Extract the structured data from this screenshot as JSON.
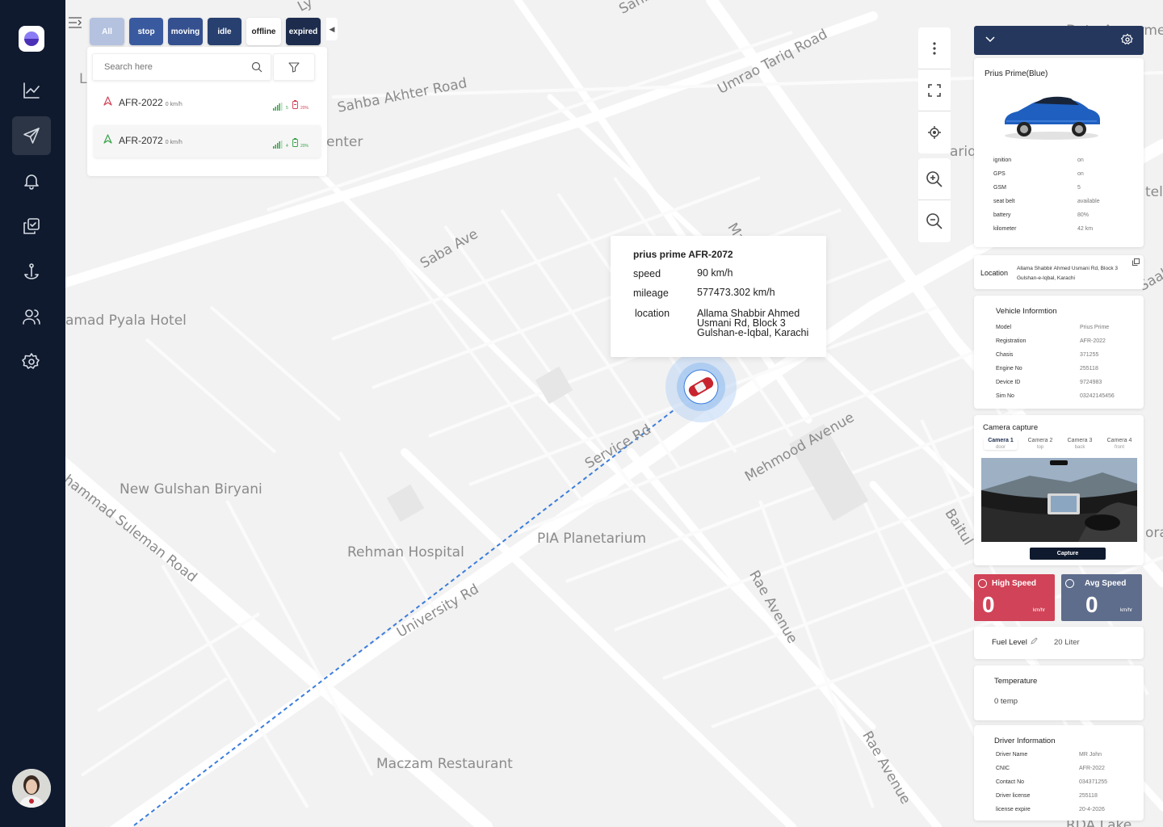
{
  "nav": {
    "items": [
      {
        "label": "analytics",
        "icon": "chart-line-icon"
      },
      {
        "label": "tracking",
        "icon": "navigation-icon",
        "active": true
      },
      {
        "label": "alerts",
        "icon": "bell-icon"
      },
      {
        "label": "tasks",
        "icon": "checklist-icon"
      },
      {
        "label": "geofence",
        "icon": "anchor-pin-icon"
      },
      {
        "label": "users",
        "icon": "users-icon"
      },
      {
        "label": "settings",
        "icon": "gear-icon"
      }
    ]
  },
  "filters": [
    {
      "label": "All",
      "color": "#b4c2e0",
      "text": "#ffffff"
    },
    {
      "label": "stop",
      "color": "#3a5a9f",
      "text": "#ffffff"
    },
    {
      "label": "moving",
      "color": "#34508f",
      "text": "#ffffff"
    },
    {
      "label": "idle",
      "color": "#27406f",
      "text": "#ffffff"
    },
    {
      "label": "offline",
      "color": "#ffffff",
      "text": "#222222"
    },
    {
      "label": "expired",
      "color": "#1d2c4d",
      "text": "#ffffff"
    }
  ],
  "search": {
    "placeholder": "Search here"
  },
  "vehicles": [
    {
      "name": "AFR-2022",
      "speed": "0 km/h",
      "signal": "5",
      "battery": "20%",
      "arrow_color": "#d14358",
      "battery_color": "#d14358"
    },
    {
      "name": "AFR-2072",
      "speed": "0 km/h",
      "signal": "4",
      "battery": "20%",
      "arrow_color": "#39a24a",
      "battery_color": "#39a24a"
    }
  ],
  "map_labels": [
    "Sahba",
    "Umrao Tariq Road",
    "Data Apparment",
    "Sahba Akhter Road",
    "enter",
    "ariq",
    "tel",
    "Saba Ave",
    "Maymar Street",
    "amad Pyala Hotel",
    "Gulsh",
    "Saah",
    "Service Rd",
    "Mehmood Avenue",
    "New Gulshan Biryani",
    "hammad Suleman Road",
    "Rehman Hospital",
    "PIA Planetarium",
    "Baitul",
    "Rae Avenue",
    "University Rd",
    "Maczam Restaurant",
    "Rae Avenue",
    "Ly",
    "L",
    "oran",
    "RDA Lake"
  ],
  "popup": {
    "title": "prius prime AFR-2072",
    "speed_label": "speed",
    "speed": "90 km/h",
    "mileage_label": "mileage",
    "mileage": "577473.302 km/h",
    "location_label": "location",
    "location": "Allama Shabbir Ahmed Usmani Rd, Block 3 Gulshan-e-Iqbal, Karachi"
  },
  "car": {
    "title": "Prius Prime(Blue)",
    "rows": [
      {
        "k": "ignition",
        "v": "on"
      },
      {
        "k": "GPS",
        "v": "on"
      },
      {
        "k": "GSM",
        "v": "5"
      },
      {
        "k": "seat belt",
        "v": "available"
      },
      {
        "k": "battery",
        "v": "80%"
      },
      {
        "k": "kilometer",
        "v": "42 km"
      }
    ]
  },
  "location": {
    "label": "Location",
    "value": "Allama Shabbir Ahmed Usmani Rd, Block 3 Gulshan-e-Iqbal, Karachi"
  },
  "vehicle_info": {
    "title": "Vehicle Informtion",
    "rows": [
      {
        "k": "Model",
        "v": "Prius Prime"
      },
      {
        "k": "Registration",
        "v": "AFR-2022"
      },
      {
        "k": "Chasis",
        "v": "371255"
      },
      {
        "k": "Engine No",
        "v": "255118"
      },
      {
        "k": "Device ID",
        "v": "9724983"
      },
      {
        "k": "Sim No",
        "v": "03242145456"
      }
    ]
  },
  "camera": {
    "title": "Camera capture",
    "tabs": [
      {
        "name": "Camera 1",
        "sub": "door"
      },
      {
        "name": "Camera 2",
        "sub": "top"
      },
      {
        "name": "Camera 3",
        "sub": "back"
      },
      {
        "name": "Camera 4",
        "sub": "front"
      }
    ],
    "capture_label": "Capture"
  },
  "high_speed": {
    "label": "High Speed",
    "value": "0",
    "unit": "km/hr",
    "color": "#d14358"
  },
  "avg_speed": {
    "label": "Avg Speed",
    "value": "0",
    "unit": "km/hr",
    "color": "#5f6d8c"
  },
  "fuel": {
    "label": "Fuel Level",
    "value": "20 Liter"
  },
  "temperature": {
    "label": "Temperature",
    "value": "0 temp"
  },
  "driver": {
    "title": "Driver Information",
    "rows": [
      {
        "k": "Driver Name",
        "v": "MR John"
      },
      {
        "k": "CNIC",
        "v": "AFR-2022"
      },
      {
        "k": "Contact No",
        "v": "034371255"
      },
      {
        "k": "Driver license",
        "v": "255118"
      },
      {
        "k": "license expire",
        "v": "20-4-2026"
      }
    ]
  }
}
